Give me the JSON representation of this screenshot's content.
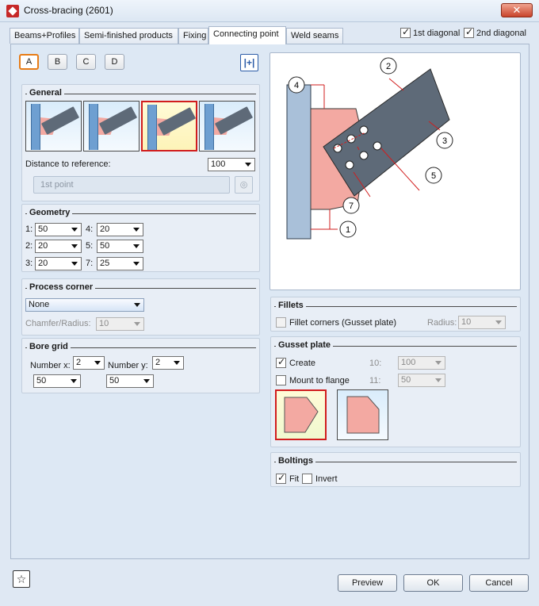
{
  "window": {
    "title": "Cross-bracing (2601)",
    "close_label": "✕"
  },
  "tabs": [
    "Beams+Profiles",
    "Semi-finished products",
    "Fixing",
    "Connecting point",
    "Weld seams"
  ],
  "header_checks": {
    "first_label": "1st diagonal",
    "first_checked": true,
    "second_label": "2nd diagonal",
    "second_checked": true
  },
  "variants": [
    "A",
    "B",
    "C",
    "D"
  ],
  "general": {
    "title": "General",
    "distance_label": "Distance to reference:",
    "distance_value": "100",
    "point_placeholder": "1st point"
  },
  "geometry": {
    "title": "Geometry",
    "rows": [
      {
        "l1": "1:",
        "v1": "50",
        "l2": "4:",
        "v2": "20"
      },
      {
        "l1": "2:",
        "v1": "20",
        "l2": "5:",
        "v2": "50"
      },
      {
        "l1": "3:",
        "v1": "20",
        "l2": "7:",
        "v2": "25"
      }
    ]
  },
  "process_corner": {
    "title": "Process corner",
    "value": "None",
    "chamfer_label": "Chamfer/Radius:",
    "chamfer_value": "10"
  },
  "bore_grid": {
    "title": "Bore grid",
    "nx_label": "Number x:",
    "nx_value": "2",
    "ny_label": "Number y:",
    "ny_value": "2",
    "dx_value": "50",
    "dy_value": "50"
  },
  "preview_labels": [
    "1",
    "2",
    "3",
    "4",
    "5",
    "7"
  ],
  "fillets": {
    "title": "Fillets",
    "label": "Fillet corners (Gusset plate)",
    "radius_label": "Radius:",
    "radius_value": "10"
  },
  "gusset": {
    "title": "Gusset plate",
    "create_label": "Create",
    "mount_label": "Mount to flange",
    "f10_label": "10:",
    "f10_value": "100",
    "f11_label": "11:",
    "f11_value": "50"
  },
  "boltings": {
    "title": "Boltings",
    "fit_label": "Fit",
    "invert_label": "Invert"
  },
  "buttons": {
    "preview": "Preview",
    "ok": "OK",
    "cancel": "Cancel",
    "favorite": "☆"
  },
  "colors": {
    "gusset": "#f3a9a2",
    "beam": "#6e9fd1",
    "brace": "#5e6a78",
    "selected_border": "#d11d1d",
    "active_variant": "#e77c17"
  }
}
